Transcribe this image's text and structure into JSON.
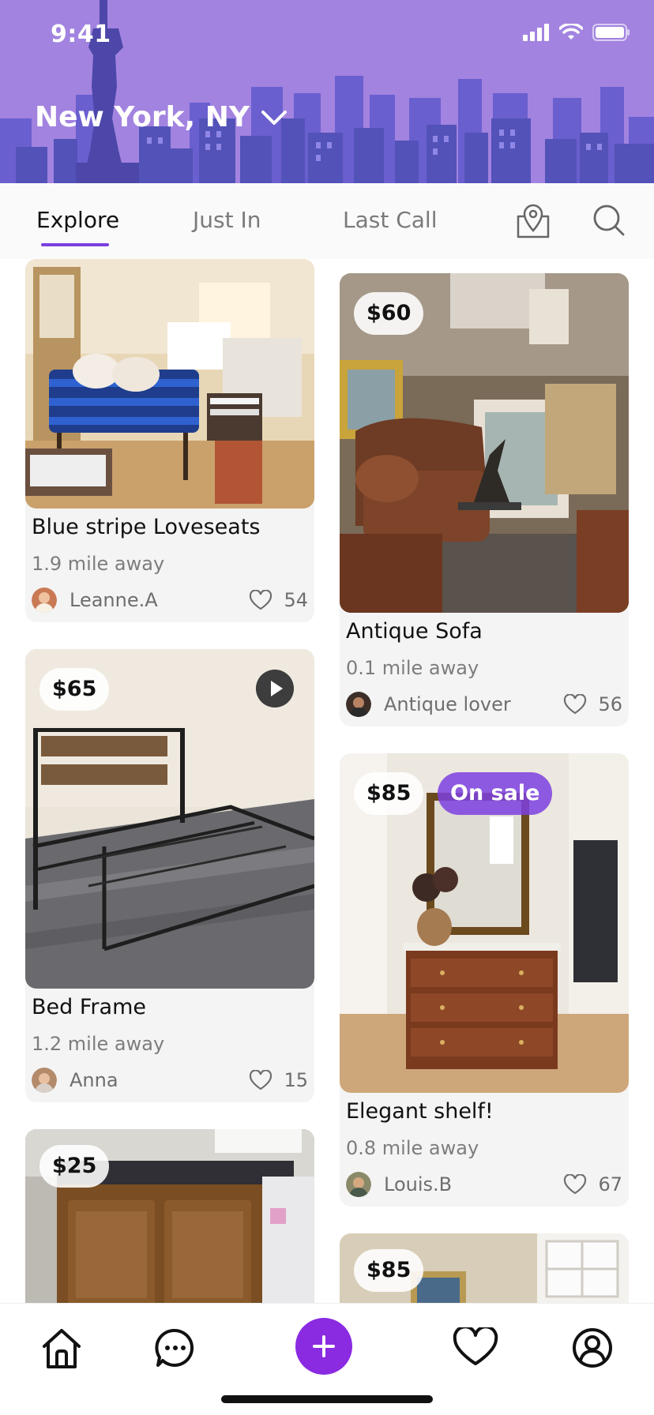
{
  "status_bar": {
    "time": "9:41"
  },
  "header": {
    "location": "New York, NY"
  },
  "tabs": [
    {
      "label": "Explore",
      "active": true
    },
    {
      "label": "Just In",
      "active": false
    },
    {
      "label": "Last Call",
      "active": false
    }
  ],
  "tab_icons": [
    "map-pin-icon",
    "search-icon"
  ],
  "listings": [
    {
      "title": "Blue stripe Loveseats",
      "distance": "1.9 mile away",
      "user": "Leanne.A",
      "likes": "54"
    },
    {
      "title": "Antique Sofa",
      "price": "$60",
      "distance": "0.1 mile away",
      "user": "Antique lover",
      "likes": "56"
    },
    {
      "title": "Bed Frame",
      "price": "$65",
      "distance": "1.2 mile away",
      "user": "Anna",
      "likes": "15",
      "has_video": true
    },
    {
      "title": "Elegant shelf!",
      "price": "$85",
      "badge": "On sale",
      "distance": "0.8 mile away",
      "user": "Louis.B",
      "likes": "67"
    },
    {
      "price": "$25"
    },
    {
      "price": "$85"
    }
  ],
  "bottom_nav": [
    "home-icon",
    "chat-icon",
    "add-icon",
    "heart-icon",
    "profile-icon"
  ],
  "colors": {
    "header": "#a283e0",
    "accent": "#7c3fe0",
    "add_button": "#8a2be2"
  }
}
